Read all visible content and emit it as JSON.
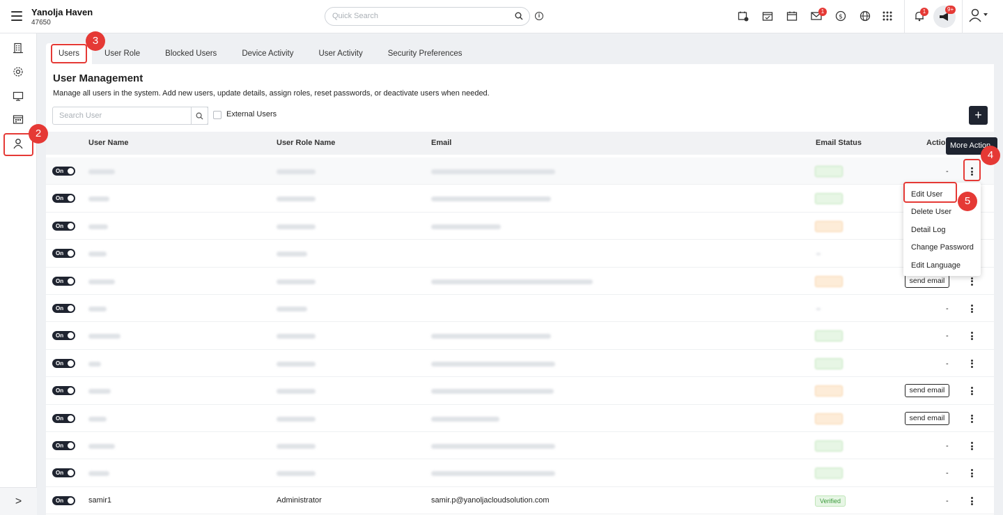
{
  "header": {
    "hotel_name": "Yanolja Haven",
    "hotel_id": "47650",
    "search_placeholder": "Quick Search",
    "mail_badge": "1",
    "notification_badge": "1",
    "announcement_badge": "9+",
    "info_glyph": "i"
  },
  "sidebar": {
    "items": [
      "building-icon",
      "settings-icon",
      "monitor-icon",
      "calendar-icon",
      "user-icon"
    ],
    "expand_glyph": ">"
  },
  "tabs": [
    {
      "label": "Users"
    },
    {
      "label": "User Role"
    },
    {
      "label": "Blocked Users"
    },
    {
      "label": "Device Activity"
    },
    {
      "label": "User Activity"
    },
    {
      "label": "Security Preferences"
    }
  ],
  "page": {
    "title": "User Management",
    "description": "Manage all users in the system. Add new users, update details, assign roles, reset passwords, or deactivate users when needed.",
    "search_placeholder": "Search User",
    "external_users_label": "External Users",
    "add_glyph": "+"
  },
  "table": {
    "columns": [
      "User Name",
      "User Role Name",
      "Email",
      "Email Status",
      "Action"
    ],
    "toggle_label": "On",
    "dash": "-",
    "send_email_label": "send email",
    "last_row": {
      "user_name": "samir1",
      "role": "Administrator",
      "email": "samir.p@yanoljacloudsolution.com",
      "status": "Verified"
    }
  },
  "tooltip": "More Action",
  "action_menu": [
    "Edit User",
    "Delete User",
    "Detail Log",
    "Change Password",
    "Edit Language"
  ],
  "callouts": [
    "2",
    "3",
    "4",
    "5"
  ],
  "colors": {
    "accent_dark": "#1f2430",
    "callout_red": "#e53935",
    "verified_green": "#3a9a3a",
    "pending_orange": "#d58a3a"
  }
}
